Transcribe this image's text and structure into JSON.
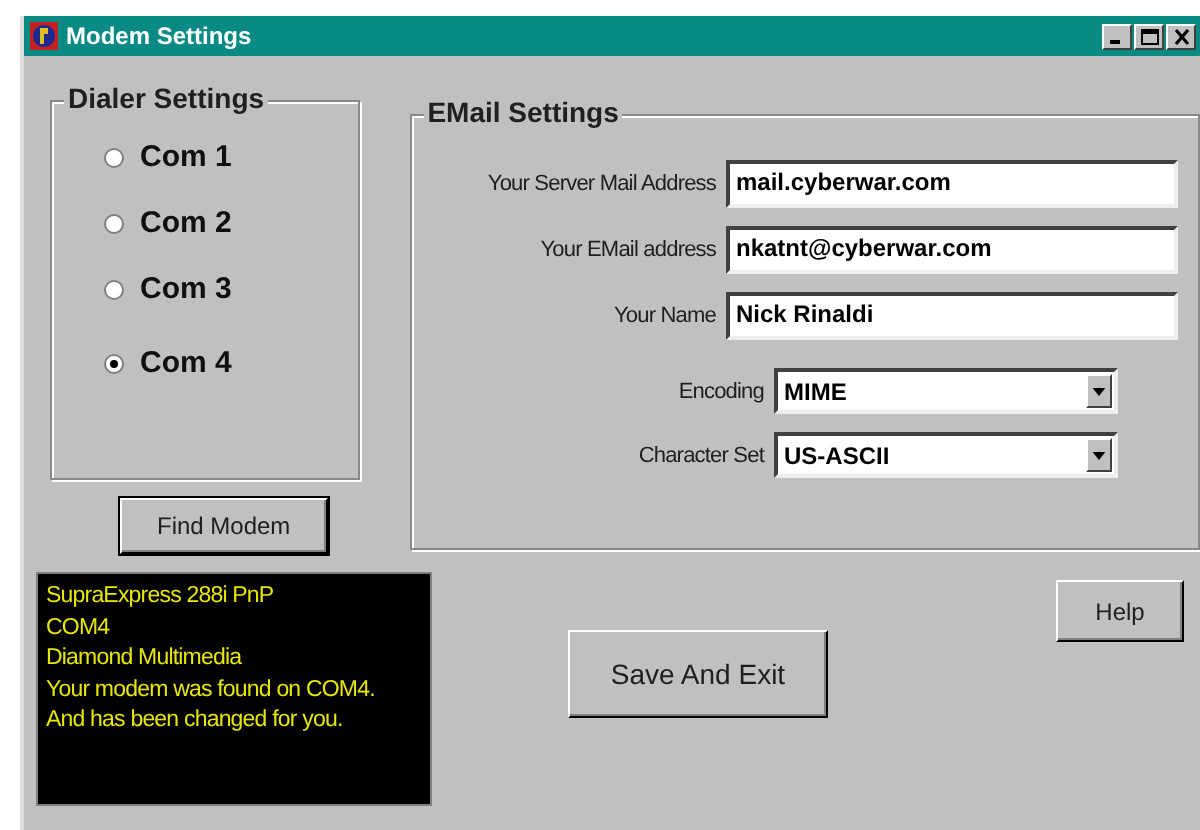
{
  "window": {
    "title": "Modem Settings"
  },
  "dialer": {
    "title": "Dialer Settings",
    "ports": [
      {
        "label": "Com 1",
        "selected": false
      },
      {
        "label": "Com 2",
        "selected": false
      },
      {
        "label": "Com 3",
        "selected": false
      },
      {
        "label": "Com 4",
        "selected": true
      }
    ]
  },
  "find_button": "Find Modem",
  "email": {
    "title": "EMail Settings",
    "fields": [
      {
        "kind": "text",
        "label": "Your Server Mail Address",
        "value": "mail.cyberwar.com"
      },
      {
        "kind": "text",
        "label": "Your EMail address",
        "value": "nkatnt@cyberwar.com"
      },
      {
        "kind": "text",
        "label": "Your Name",
        "value": "Nick Rinaldi"
      },
      {
        "kind": "dropdown",
        "label": "Encoding",
        "value": "MIME"
      },
      {
        "kind": "dropdown",
        "label": "Character Set",
        "value": "US-ASCII"
      }
    ]
  },
  "status_lines": [
    "SupraExpress 288i PnP",
    "COM4",
    "Diamond Multimedia",
    "Your modem was found on COM4. And has been changed for you."
  ],
  "save_button": "Save And Exit",
  "help_button": "Help"
}
